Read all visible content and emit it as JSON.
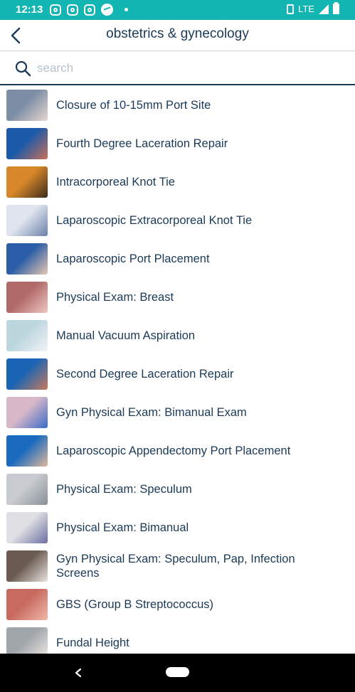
{
  "status_bar": {
    "time": "12:13",
    "network": "LTE",
    "color": "#12b5b1"
  },
  "header": {
    "title": "obstetrics & gynecology",
    "back_icon": "chevron-left-icon"
  },
  "search": {
    "placeholder": "search",
    "value": ""
  },
  "procedures": [
    {
      "label": "Closure of 10-15mm Port Site",
      "thumb_colors": [
        "#7c8ea6",
        "#e8d6d0"
      ]
    },
    {
      "label": "Fourth Degree Laceration Repair",
      "thumb_colors": [
        "#1a5aa8",
        "#c8705a"
      ]
    },
    {
      "label": "Intracorporeal Knot Tie",
      "thumb_colors": [
        "#d8882a",
        "#3a2a1a"
      ]
    },
    {
      "label": "Laparoscopic Extracorporeal Knot Tie",
      "thumb_colors": [
        "#dfe4ee",
        "#6a7fa8"
      ]
    },
    {
      "label": "Laparoscopic Port Placement",
      "thumb_colors": [
        "#2a5ea8",
        "#e8c6b0"
      ]
    },
    {
      "label": "Physical Exam: Breast",
      "thumb_colors": [
        "#b06a6a",
        "#f0c8c0"
      ]
    },
    {
      "label": "Manual Vacuum Aspiration",
      "thumb_colors": [
        "#bcd6de",
        "#f2f4f6"
      ]
    },
    {
      "label": "Second Degree Laceration Repair",
      "thumb_colors": [
        "#1a64b4",
        "#c87a5a"
      ]
    },
    {
      "label": "Gyn Physical Exam: Bimanual Exam",
      "thumb_colors": [
        "#d8b8c8",
        "#3a6ac8"
      ]
    },
    {
      "label": "Laparoscopic Appendectomy Port Placement",
      "thumb_colors": [
        "#1a6ac0",
        "#e0b89a"
      ]
    },
    {
      "label": "Physical Exam: Speculum",
      "thumb_colors": [
        "#c8ccd0",
        "#8a9098"
      ]
    },
    {
      "label": "Physical Exam: Bimanual",
      "thumb_colors": [
        "#e0e0e4",
        "#6a6ea0"
      ]
    },
    {
      "label": "Gyn Physical Exam: Speculum, Pap, Infection Screens",
      "thumb_colors": [
        "#6a5a50",
        "#e8e4e0"
      ]
    },
    {
      "label": "GBS (Group B Streptococcus)",
      "thumb_colors": [
        "#c86a60",
        "#f0b8a8"
      ]
    },
    {
      "label": "Fundal Height",
      "thumb_colors": [
        "#a0a6aa",
        "#f0e8e4"
      ]
    }
  ],
  "nav_bar": {
    "back_icon": "triangle-back-icon",
    "home_icon": "home-pill-icon"
  }
}
